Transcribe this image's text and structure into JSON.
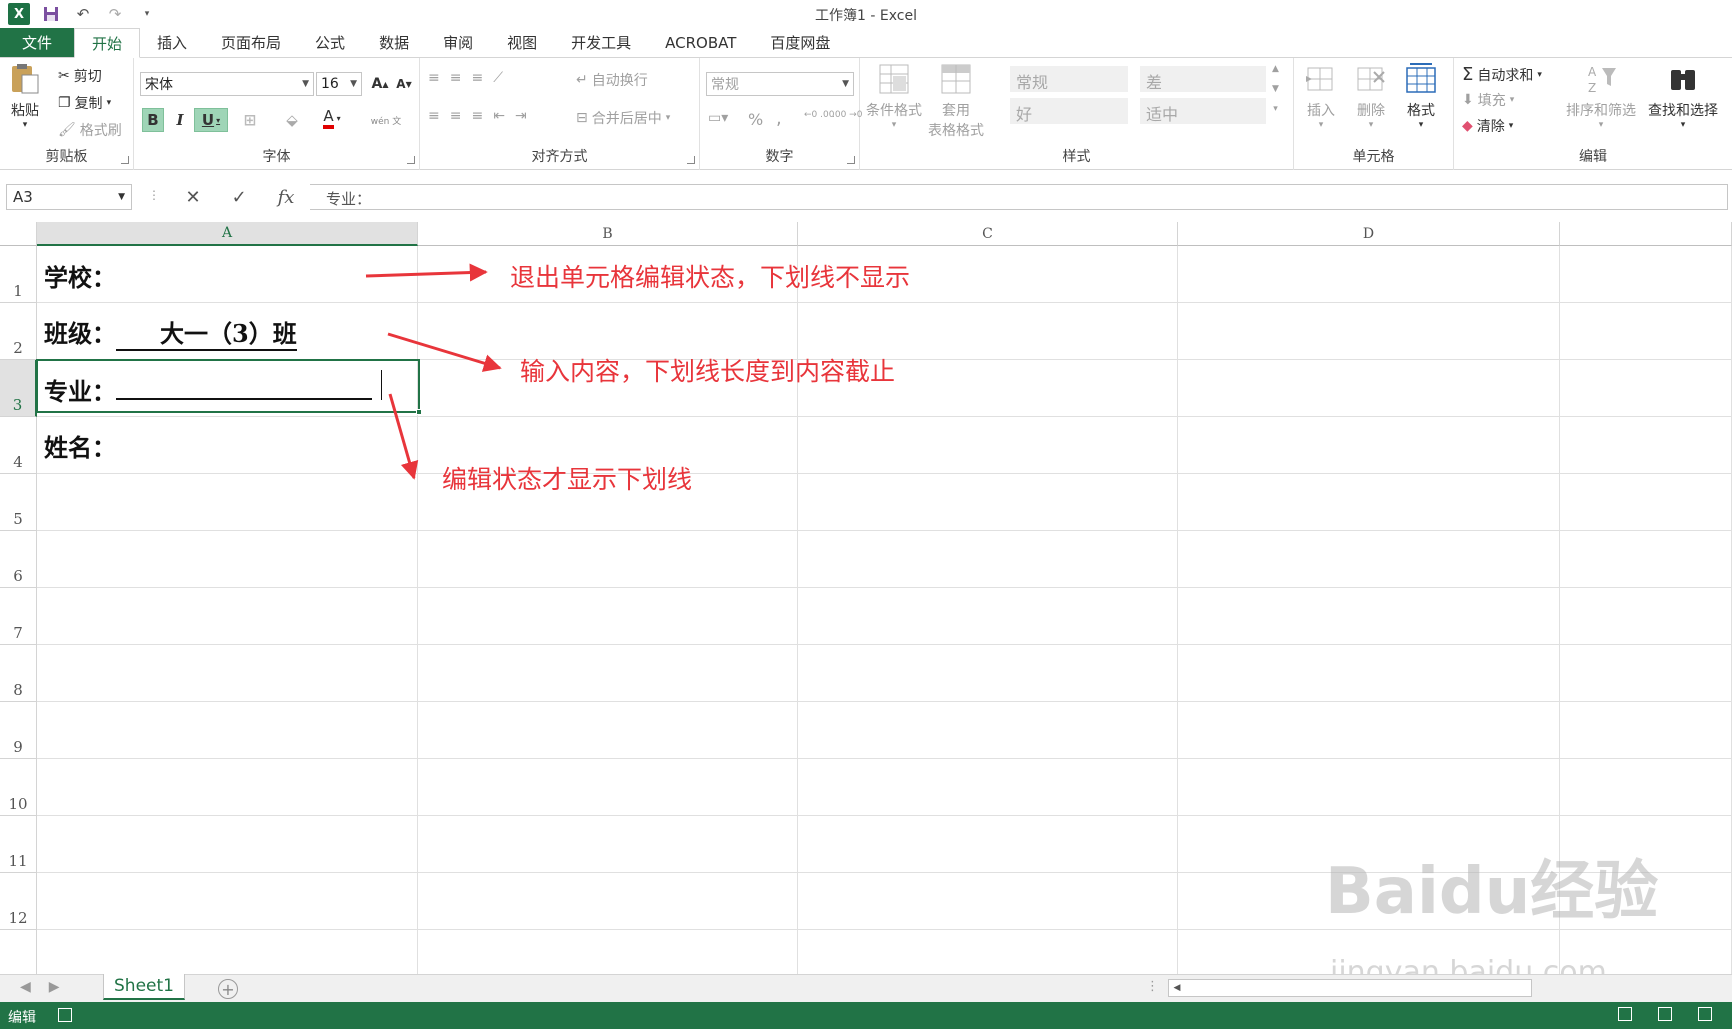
{
  "window": {
    "title": "工作簿1 - Excel"
  },
  "qat": {
    "app_icon": "X"
  },
  "tabs": [
    "文件",
    "开始",
    "插入",
    "页面布局",
    "公式",
    "数据",
    "审阅",
    "视图",
    "开发工具",
    "ACROBAT",
    "百度网盘"
  ],
  "active_tab": "开始",
  "ribbon": {
    "clipboard": {
      "label": "剪贴板",
      "paste": "粘贴",
      "cut": "剪切",
      "copy": "复制",
      "format_painter": "格式刷"
    },
    "font": {
      "label": "字体",
      "font_name": "宋体",
      "font_size": "16",
      "bold": "B",
      "italic": "I",
      "underline": "U",
      "increase": "A",
      "decrease": "A",
      "font_color_letter": "A",
      "font_color": "#e00000",
      "phonetic": "wén 文"
    },
    "alignment": {
      "label": "对齐方式",
      "wrap_text": "自动换行",
      "merge_center": "合并后居中"
    },
    "number": {
      "label": "数字",
      "format": "常规",
      "percent": "%",
      "comma": ","
    },
    "styles": {
      "label": "样式",
      "conditional": "条件格式",
      "table_format_1": "套用",
      "table_format_2": "表格格式",
      "normal": "常规",
      "bad": "差",
      "good": "好",
      "neutral": "适中"
    },
    "cells": {
      "label": "单元格",
      "insert": "插入",
      "delete": "删除",
      "format": "格式"
    },
    "editing": {
      "label": "编辑",
      "autosum": "自动求和",
      "fill": "填充",
      "clear": "清除",
      "sort_filter": "排序和筛选",
      "find_select": "查找和选择"
    }
  },
  "formula_bar": {
    "name_box": "A3",
    "cancel": "✕",
    "enter": "✓",
    "fx": "fx",
    "content": "专业："
  },
  "columns": [
    "A",
    "B",
    "C",
    "D"
  ],
  "rows": [
    "1",
    "2",
    "3",
    "4",
    "5",
    "6",
    "7",
    "8",
    "9",
    "10",
    "11",
    "12"
  ],
  "cells": {
    "a1": "学校：",
    "a2_label": "班级：",
    "a2_value": "大一（3）班",
    "a3": "专业：",
    "a4": "姓名："
  },
  "annotations": {
    "note1": "退出单元格编辑状态，下划线不显示",
    "note2": "输入内容，下划线长度到内容截止",
    "note3": "编辑状态才显示下划线",
    "color": "#e8353b"
  },
  "sheets": [
    "Sheet1"
  ],
  "status": {
    "mode": "编辑"
  },
  "watermark": {
    "line1": "Baidu经验",
    "line2": "jingyan.baidu.com"
  }
}
